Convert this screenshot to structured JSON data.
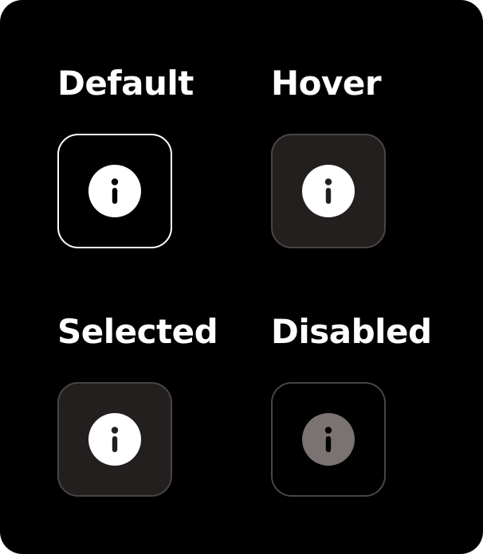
{
  "states": {
    "default": {
      "label": "Default",
      "icon": "info-icon"
    },
    "hover": {
      "label": "Hover",
      "icon": "info-icon"
    },
    "selected": {
      "label": "Selected",
      "icon": "info-icon"
    },
    "disabled": {
      "label": "Disabled",
      "icon": "info-icon"
    }
  },
  "colors": {
    "background": "#000000",
    "text": "#ffffff",
    "tile_filled": "#231f1e",
    "tile_border_muted": "#4a4544",
    "tile_border_default": "#ffffff",
    "icon_enabled": "#ffffff",
    "icon_disabled": "#7a7371"
  }
}
